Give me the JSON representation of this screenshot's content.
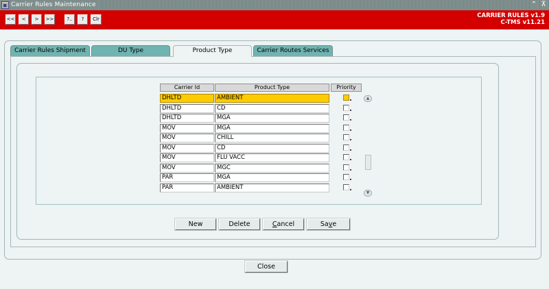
{
  "window": {
    "title": "Carrier Rules Maintenance",
    "minimize_glyph": "⌃",
    "maximize_glyph": "⊼"
  },
  "toolbar": {
    "buttons": [
      {
        "id": "first",
        "label": "<<"
      },
      {
        "id": "prev",
        "label": "<"
      },
      {
        "id": "next",
        "label": ">"
      },
      {
        "id": "last",
        "label": ">>"
      },
      {
        "id": "query",
        "label": "?.."
      },
      {
        "id": "help",
        "label": "?"
      },
      {
        "id": "clear",
        "label": "Clr"
      }
    ],
    "version_line1": "CARRIER  RULES v1.9",
    "version_line2": "C-TMS v11.21",
    "background_color": "#d40000"
  },
  "tabs": [
    {
      "label": "Carrier Rules Shipment",
      "active": false
    },
    {
      "label": "DU Type",
      "active": false
    },
    {
      "label": "Product Type",
      "active": true
    },
    {
      "label": "Carrier Routes Services",
      "active": false
    }
  ],
  "grid": {
    "headers": {
      "carrier_id": "Carrier Id",
      "product_type": "Product Type",
      "priority": "Priority"
    },
    "rows": [
      {
        "carrier_id": "DHLTD",
        "product_type": "AMBIENT",
        "priority": false,
        "selected": true
      },
      {
        "carrier_id": "DHLTD",
        "product_type": "CD",
        "priority": false
      },
      {
        "carrier_id": "DHLTD",
        "product_type": "MGA",
        "priority": false
      },
      {
        "carrier_id": "MOV",
        "product_type": "MGA",
        "priority": false
      },
      {
        "carrier_id": "MOV",
        "product_type": "CHILL",
        "priority": false
      },
      {
        "carrier_id": "MOV",
        "product_type": "CD",
        "priority": false
      },
      {
        "carrier_id": "MOV",
        "product_type": "FLU VACC",
        "priority": false
      },
      {
        "carrier_id": "MOV",
        "product_type": "MGC",
        "priority": false
      },
      {
        "carrier_id": "PAR",
        "product_type": "MGA",
        "priority": false
      },
      {
        "carrier_id": "PAR",
        "product_type": "AMBIENT",
        "priority": false
      }
    ],
    "selected_color": "#ffcc00"
  },
  "actions": {
    "new": "New",
    "delete": "Delete",
    "cancel_underline": "C",
    "cancel_rest": "ancel",
    "save_first": "Sa",
    "save_underline": "v",
    "save_rest": "e"
  },
  "close_label": "Close",
  "icons": {
    "app": "app-icon",
    "scroll_up": "scroll-up-icon",
    "scroll_down": "scroll-down-icon"
  }
}
